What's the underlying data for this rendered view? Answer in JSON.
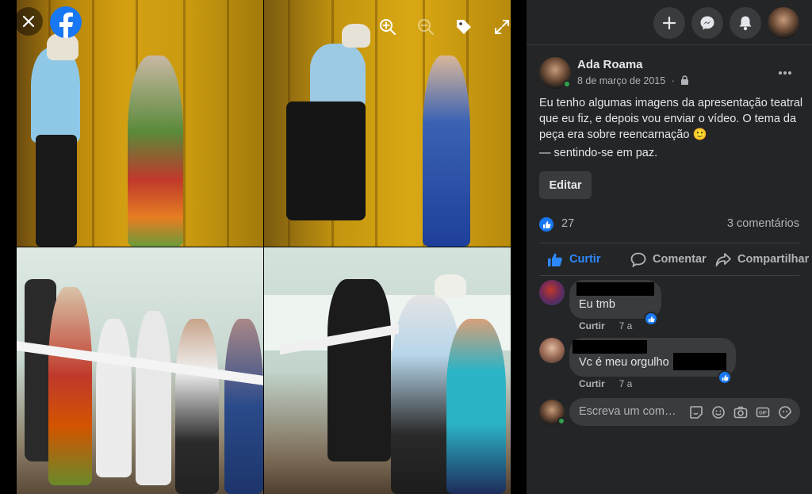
{
  "viewer": {
    "photos": [
      "photo-stage-1",
      "photo-stage-2",
      "photo-cast-1",
      "photo-cast-2"
    ],
    "controls": [
      "close-icon",
      "facebook-logo",
      "zoom-in-icon",
      "zoom-out-icon",
      "tag-icon",
      "fullscreen-icon"
    ]
  },
  "topbar": {
    "icons": [
      "plus-icon",
      "messenger-icon",
      "notifications-icon",
      "profile-avatar"
    ]
  },
  "post": {
    "author": "Ada Roama",
    "date": "8 de março de 2015",
    "date_separator": "·",
    "privacy_icon": "lock-icon",
    "text": "Eu tenho algumas imagens da apresentação teatral que eu fiz, e depois vou enviar o vídeo. O tema da peça era sobre reencarnação",
    "emoji": "🙂",
    "feeling": "— sentindo-se em paz.",
    "edit_label": "Editar",
    "like_count": "27",
    "comment_count": "3 comentários"
  },
  "actions": {
    "like": "Curtir",
    "comment": "Comentar",
    "share": "Compartilhar"
  },
  "comments": [
    {
      "text": "Eu tmb",
      "like": "Curtir",
      "time": "7 a"
    },
    {
      "text": "Vc é meu orgulho",
      "like": "Curtir",
      "time": "7 a"
    }
  ],
  "composer": {
    "placeholder": "Escreva um com…",
    "icons": [
      "sticker-icon",
      "emoji-icon",
      "camera-icon",
      "gif-icon",
      "avatar-sticker-icon"
    ]
  },
  "colors": {
    "accent": "#1877f2",
    "panel_bg": "#242526",
    "bubble_bg": "#3a3b3c",
    "online": "#31a24c"
  }
}
